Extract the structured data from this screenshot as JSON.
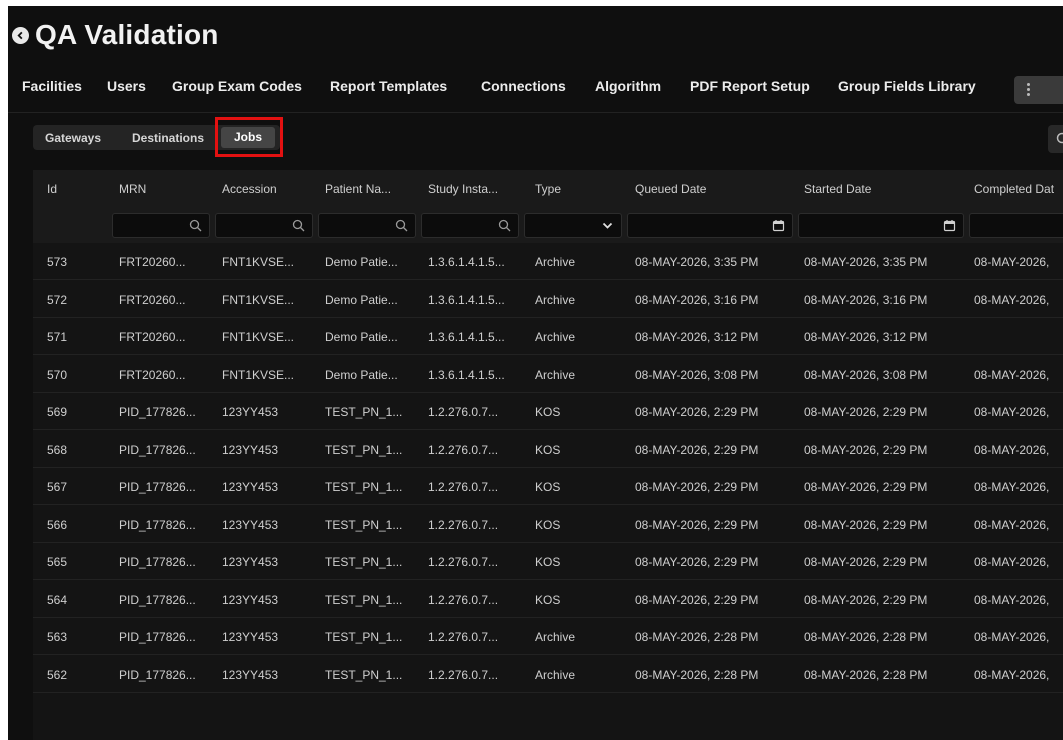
{
  "header": {
    "title": "QA Validation"
  },
  "main_tabs": [
    "Facilities",
    "Users",
    "Group Exam Codes",
    "Report Templates",
    "Connections",
    "Algorithm",
    "PDF Report Setup",
    "Group Fields Library"
  ],
  "sub_tabs": [
    "Gateways",
    "Destinations",
    "Jobs"
  ],
  "table": {
    "columns": [
      "Id",
      "MRN",
      "Accession",
      "Patient Na...",
      "Study Insta...",
      "Type",
      "Queued Date",
      "Started Date",
      "Completed Dat"
    ],
    "filters": [
      {
        "kind": "search"
      },
      {
        "kind": "search"
      },
      {
        "kind": "search"
      },
      {
        "kind": "search"
      },
      {
        "kind": "select"
      },
      {
        "kind": "date"
      },
      {
        "kind": "date"
      },
      {
        "kind": "text"
      }
    ],
    "rows": [
      [
        "573",
        "FRT20260...",
        "FNT1KVSE...",
        "Demo Patie...",
        "1.3.6.1.4.1.5...",
        "Archive",
        "08-MAY-2026, 3:35 PM",
        "08-MAY-2026, 3:35 PM",
        "08-MAY-2026,"
      ],
      [
        "572",
        "FRT20260...",
        "FNT1KVSE...",
        "Demo Patie...",
        "1.3.6.1.4.1.5...",
        "Archive",
        "08-MAY-2026, 3:16 PM",
        "08-MAY-2026, 3:16 PM",
        "08-MAY-2026,"
      ],
      [
        "571",
        "FRT20260...",
        "FNT1KVSE...",
        "Demo Patie...",
        "1.3.6.1.4.1.5...",
        "Archive",
        "08-MAY-2026, 3:12 PM",
        "08-MAY-2026, 3:12 PM",
        ""
      ],
      [
        "570",
        "FRT20260...",
        "FNT1KVSE...",
        "Demo Patie...",
        "1.3.6.1.4.1.5...",
        "Archive",
        "08-MAY-2026, 3:08 PM",
        "08-MAY-2026, 3:08 PM",
        "08-MAY-2026,"
      ],
      [
        "569",
        "PID_177826...",
        "123YY453",
        "TEST_PN_1...",
        "1.2.276.0.7...",
        "KOS",
        "08-MAY-2026, 2:29 PM",
        "08-MAY-2026, 2:29 PM",
        "08-MAY-2026,"
      ],
      [
        "568",
        "PID_177826...",
        "123YY453",
        "TEST_PN_1...",
        "1.2.276.0.7...",
        "KOS",
        "08-MAY-2026, 2:29 PM",
        "08-MAY-2026, 2:29 PM",
        "08-MAY-2026,"
      ],
      [
        "567",
        "PID_177826...",
        "123YY453",
        "TEST_PN_1...",
        "1.2.276.0.7...",
        "KOS",
        "08-MAY-2026, 2:29 PM",
        "08-MAY-2026, 2:29 PM",
        "08-MAY-2026,"
      ],
      [
        "566",
        "PID_177826...",
        "123YY453",
        "TEST_PN_1...",
        "1.2.276.0.7...",
        "KOS",
        "08-MAY-2026, 2:29 PM",
        "08-MAY-2026, 2:29 PM",
        "08-MAY-2026,"
      ],
      [
        "565",
        "PID_177826...",
        "123YY453",
        "TEST_PN_1...",
        "1.2.276.0.7...",
        "KOS",
        "08-MAY-2026, 2:29 PM",
        "08-MAY-2026, 2:29 PM",
        "08-MAY-2026,"
      ],
      [
        "564",
        "PID_177826...",
        "123YY453",
        "TEST_PN_1...",
        "1.2.276.0.7...",
        "KOS",
        "08-MAY-2026, 2:29 PM",
        "08-MAY-2026, 2:29 PM",
        "08-MAY-2026,"
      ],
      [
        "563",
        "PID_177826...",
        "123YY453",
        "TEST_PN_1...",
        "1.2.276.0.7...",
        "Archive",
        "08-MAY-2026, 2:28 PM",
        "08-MAY-2026, 2:28 PM",
        "08-MAY-2026,"
      ],
      [
        "562",
        "PID_177826...",
        "123YY453",
        "TEST_PN_1...",
        "1.2.276.0.7...",
        "Archive",
        "08-MAY-2026, 2:28 PM",
        "08-MAY-2026, 2:28 PM",
        "08-MAY-2026,"
      ]
    ]
  },
  "icons": {
    "back": "back-arrow-icon",
    "more": "more-vertical-icon",
    "search": "search-icon",
    "select": "chevron-down-icon",
    "date": "calendar-icon"
  },
  "colors": {
    "highlight": "#e31111",
    "background": "#0f0f0f"
  }
}
